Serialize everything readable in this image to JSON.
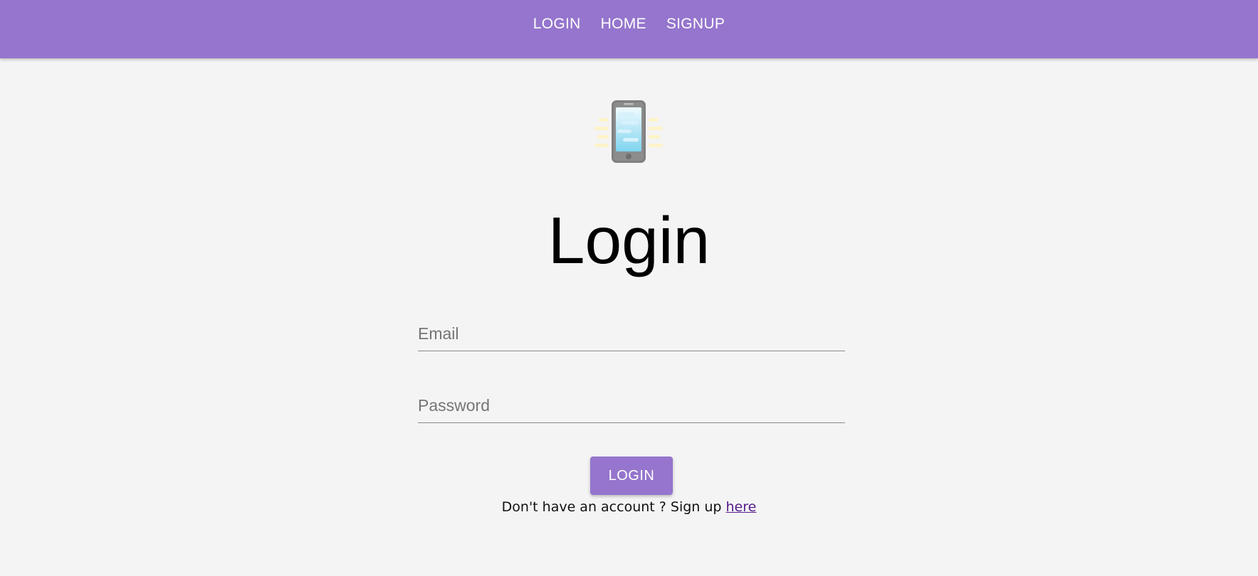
{
  "nav": {
    "links": [
      {
        "label": "LOGIN"
      },
      {
        "label": "HOME"
      },
      {
        "label": "SIGNUP"
      }
    ]
  },
  "colors": {
    "accent": "#9575cd",
    "background": "#f4f4f4",
    "link": "#551a8b"
  },
  "hero": {
    "icon": "mobile-phone-vibrating-icon"
  },
  "form": {
    "title": "Login",
    "email": {
      "placeholder": "Email",
      "value": ""
    },
    "password": {
      "placeholder": "Password",
      "value": ""
    },
    "submit_label": "LOGIN",
    "signup_prompt": "Don't have an account ? Sign up ",
    "signup_link": "here"
  }
}
